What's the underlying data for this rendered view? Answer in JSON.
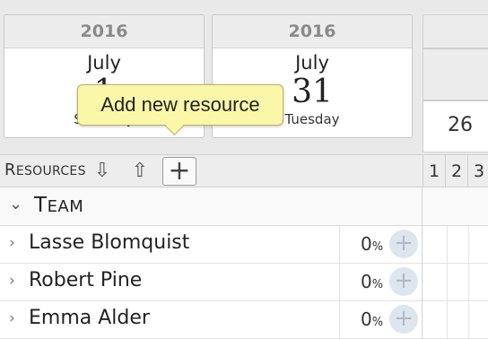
{
  "date_cards": [
    {
      "year": "2016",
      "month": "July",
      "day": "1",
      "weekday": "Saturday"
    },
    {
      "year": "2016",
      "month": "July",
      "day": "31",
      "weekday": "Tuesday"
    }
  ],
  "tooltip": {
    "text": "Add new resource"
  },
  "timeline": {
    "week_label": "26",
    "day_labels": [
      "1",
      "2",
      "3"
    ]
  },
  "toolbar": {
    "title": "Resources",
    "icons": [
      "move-down-icon",
      "move-up-icon",
      "add-icon"
    ]
  },
  "group": {
    "name": "Team"
  },
  "resources": [
    {
      "name": "Lasse Blomquist",
      "allocation": "0",
      "unit": "%"
    },
    {
      "name": "Robert Pine",
      "allocation": "0",
      "unit": "%"
    },
    {
      "name": "Emma Alder",
      "allocation": "0",
      "unit": "%"
    }
  ],
  "colors": {
    "tooltip_bg": "#fbf7a8",
    "plus_circle": "#dde6ef",
    "header_bg": "#e9e9e9"
  }
}
